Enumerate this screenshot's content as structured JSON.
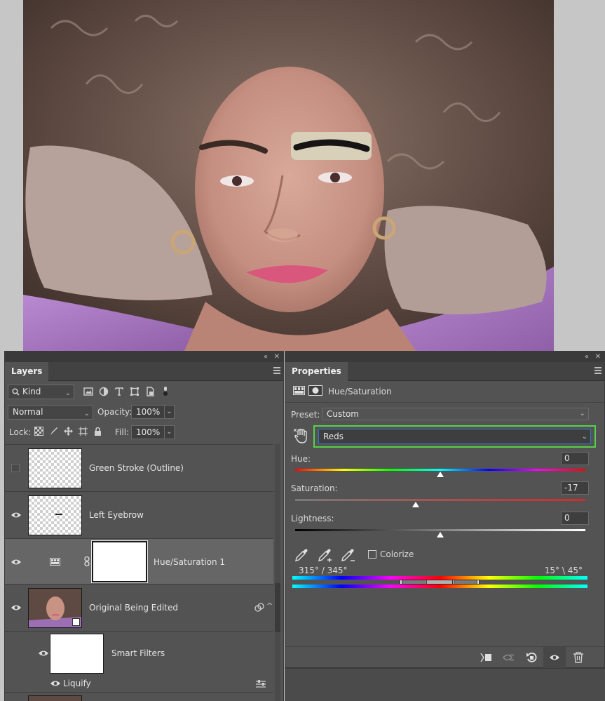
{
  "layers_panel": {
    "tab": "Layers",
    "collapse_glyph": "«",
    "close_glyph": "✕",
    "filter": {
      "label": "Kind"
    },
    "blend_mode": "Normal",
    "opacity_label": "Opacity:",
    "opacity_value": "100%",
    "lock_label": "Lock:",
    "fill_label": "Fill:",
    "fill_value": "100%",
    "layers": [
      {
        "name": "Green Stroke (Outline)",
        "visible": false
      },
      {
        "name": "Left Eyebrow",
        "visible": true
      },
      {
        "name": "Hue/Saturation 1",
        "visible": true,
        "selected": true
      },
      {
        "name": "Original Being Edited",
        "visible": true
      },
      {
        "name": "Smart Filters",
        "visible": true
      },
      {
        "name": "Liquify",
        "visible": true
      }
    ]
  },
  "properties_panel": {
    "tab": "Properties",
    "collapse_glyph": "«",
    "close_glyph": "✕",
    "title": "Hue/Saturation",
    "preset_label": "Preset:",
    "preset_value": "Custom",
    "channel_value": "Reds",
    "hue": {
      "label": "Hue:",
      "value": "0",
      "position": 0.5
    },
    "saturation": {
      "label": "Saturation:",
      "value": "-17",
      "position": 0.415
    },
    "lightness": {
      "label": "Lightness:",
      "value": "0",
      "position": 0.5
    },
    "colorize_label": "Colorize",
    "colorize_checked": false,
    "range_left": "315° / 345°",
    "range_right": "15° \\ 45°"
  },
  "colors": {
    "panel_bg": "#535353",
    "selection_highlight": "#55d14a",
    "canvas_bg": "#c6c6c6"
  }
}
